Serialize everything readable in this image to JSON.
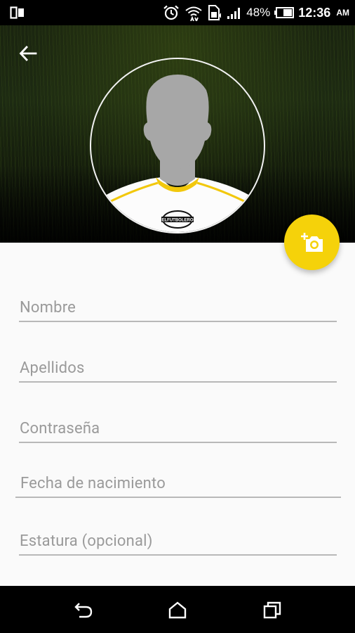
{
  "status_bar": {
    "battery_percent": "48%",
    "time": "12:36",
    "ampm": "AM"
  },
  "header": {
    "back_icon": "arrow-back-icon",
    "avatar_icon": "player-silhouette-avatar",
    "avatar_badge_text": "ELFUTBOLERO"
  },
  "fab": {
    "icon": "add-photo-camera-icon",
    "accent": "#f5d20a"
  },
  "form": {
    "nombre_label": "Nombre",
    "apellidos_label": "Apellidos",
    "contrasena_label": "Contraseña",
    "fecha_label": "Fecha de nacimiento",
    "estatura_label": "Estatura (opcional)"
  },
  "nav_bar": {
    "back_icon": "nav-back-icon",
    "home_icon": "nav-home-icon",
    "recents_icon": "nav-recents-icon"
  }
}
